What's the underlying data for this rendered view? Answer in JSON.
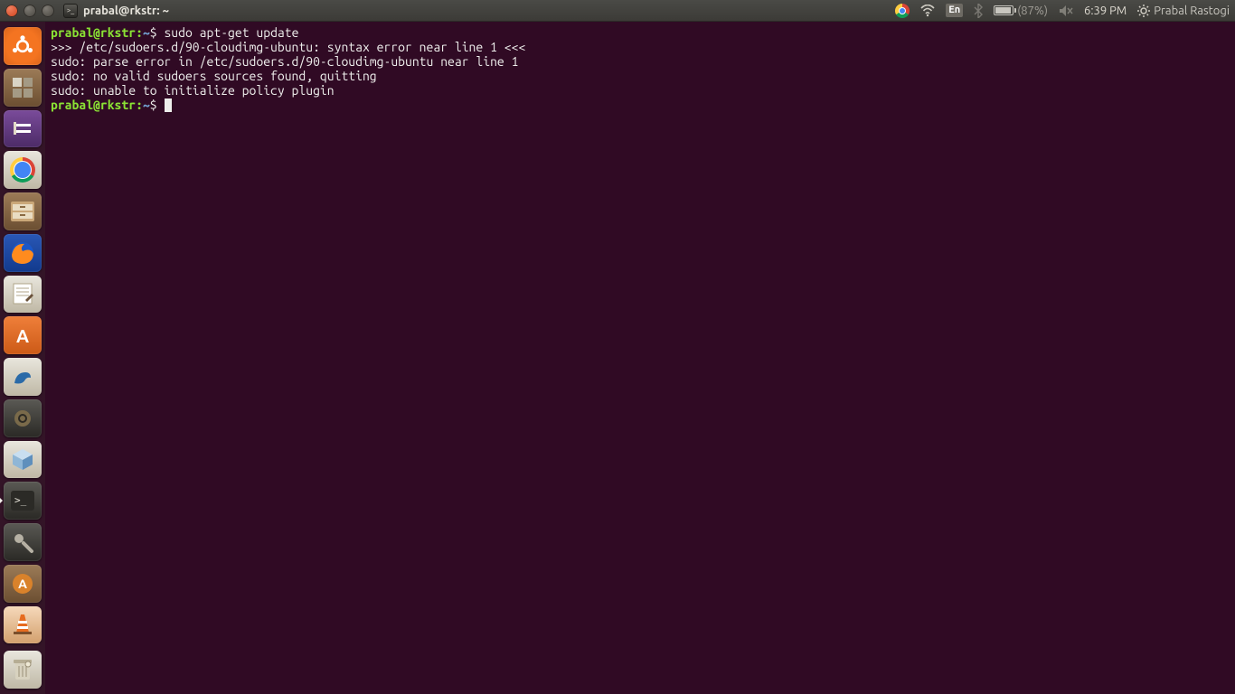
{
  "topbar": {
    "window_title": "prabal@rkstr: ~",
    "language_badge": "En",
    "battery_text": "(87%)",
    "clock": "6:39 PM",
    "user_label": "Prabal Rastogi"
  },
  "launcher": {
    "items": [
      {
        "name": "ubuntu-dash",
        "label": "Dash"
      },
      {
        "name": "workspace-switcher",
        "label": "Workspace"
      },
      {
        "name": "unknown-purple-app",
        "label": "App"
      },
      {
        "name": "google-chrome",
        "label": "Chrome"
      },
      {
        "name": "files-nautilus",
        "label": "Files"
      },
      {
        "name": "firefox",
        "label": "Firefox"
      },
      {
        "name": "text-editor",
        "label": "Editor"
      },
      {
        "name": "ubuntu-software",
        "label": "A"
      },
      {
        "name": "mysql-workbench",
        "label": "WB"
      },
      {
        "name": "ide-app",
        "label": "IDE"
      },
      {
        "name": "virtualbox",
        "label": "VB"
      },
      {
        "name": "terminal",
        "label": ">_"
      },
      {
        "name": "system-settings",
        "label": "⚙"
      },
      {
        "name": "software-updater",
        "label": "A"
      },
      {
        "name": "vlc",
        "label": "▲"
      }
    ],
    "trash_label": "Trash"
  },
  "terminal": {
    "prompt_user_host": "prabal@rkstr",
    "prompt_path": "~",
    "command": "sudo apt-get update",
    "output_lines": [
      ">>> /etc/sudoers.d/90-cloudimg-ubuntu: syntax error near line 1 <<<",
      "sudo: parse error in /etc/sudoers.d/90-cloudimg-ubuntu near line 1",
      "sudo: no valid sudoers sources found, quitting",
      "sudo: unable to initialize policy plugin"
    ]
  }
}
